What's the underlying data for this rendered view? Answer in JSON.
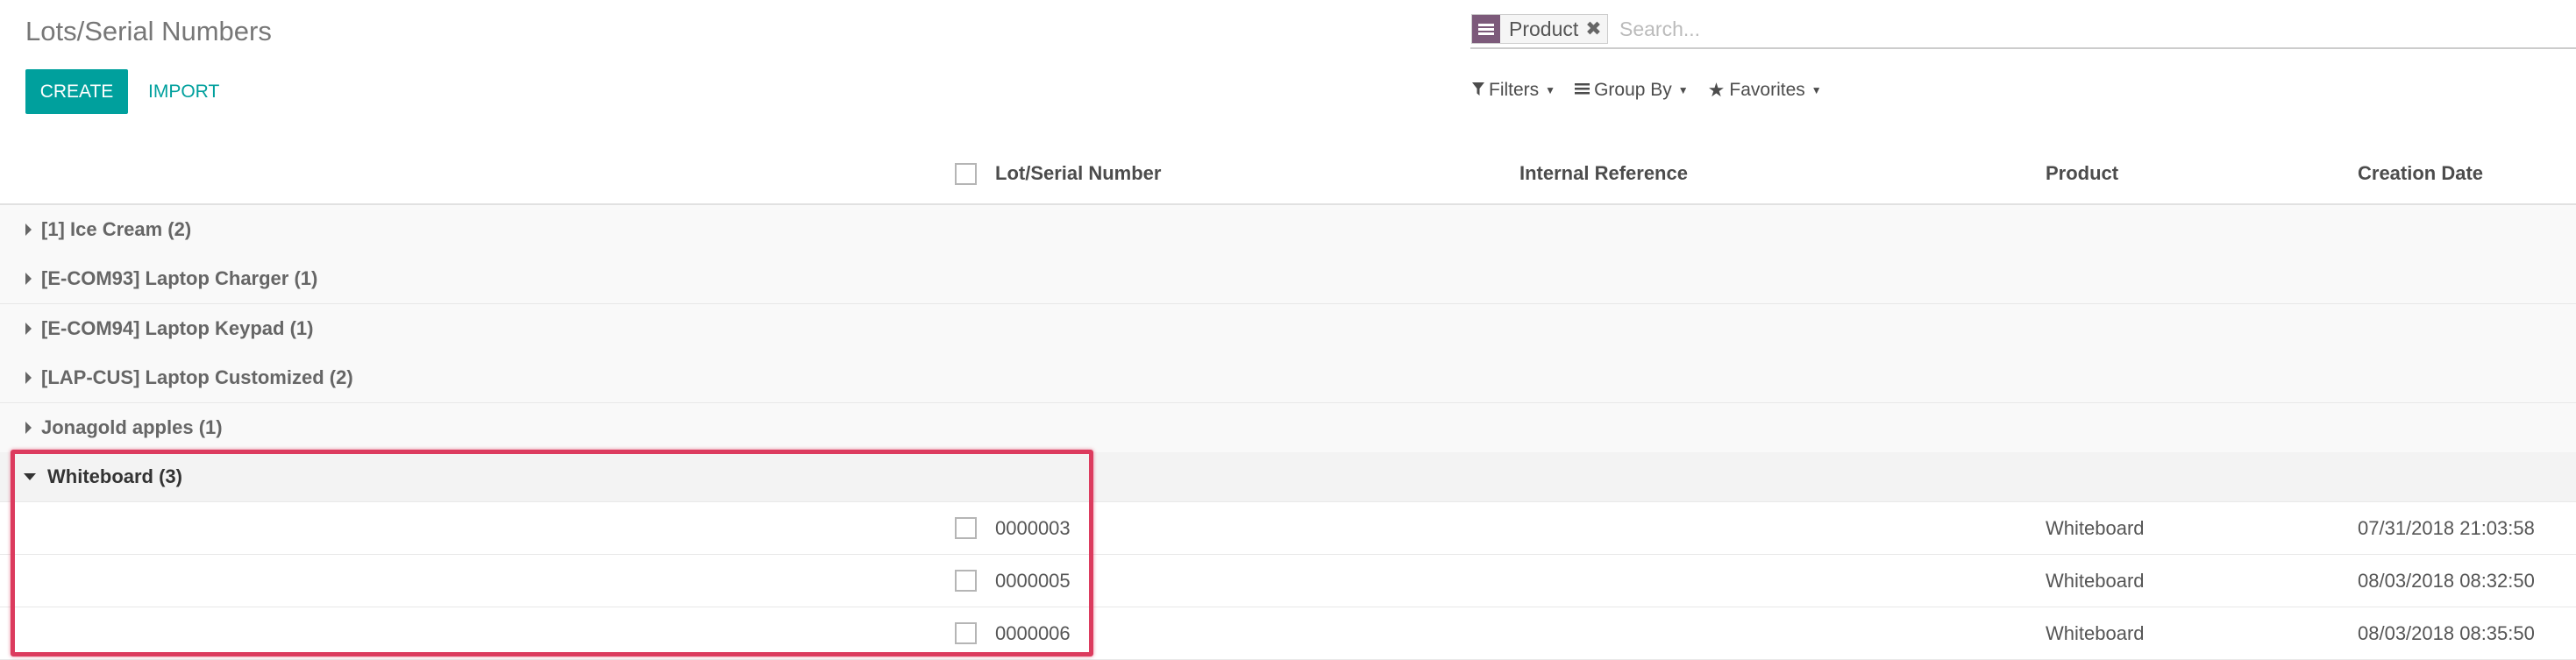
{
  "page": {
    "title": "Lots/Serial Numbers",
    "create_label": "CREATE",
    "import_label": "IMPORT"
  },
  "search": {
    "facet_value": "Product",
    "placeholder": "Search...",
    "facet_icon": "group-by-icon",
    "remove_icon": "close-icon"
  },
  "tools": {
    "filters": "Filters",
    "group_by": "Group By",
    "favorites": "Favorites"
  },
  "columns": {
    "lot": "Lot/Serial Number",
    "ref": "Internal Reference",
    "product": "Product",
    "date": "Creation Date"
  },
  "groups": [
    {
      "label": "[1] Ice Cream (2)"
    },
    {
      "label": "[E-COM93] Laptop Charger (1)"
    },
    {
      "label": "[E-COM94] Laptop Keypad (1)"
    },
    {
      "label": "[LAP-CUS] Laptop Customized (2)"
    },
    {
      "label": "Jonagold apples (1)"
    },
    {
      "label": "Whiteboard (3)",
      "expanded": true
    }
  ],
  "rows": [
    {
      "lot": "0000003",
      "ref": "",
      "product": "Whiteboard",
      "date": "07/31/2018 21:03:58"
    },
    {
      "lot": "0000005",
      "ref": "",
      "product": "Whiteboard",
      "date": "08/03/2018 08:32:50"
    },
    {
      "lot": "0000006",
      "ref": "",
      "product": "Whiteboard",
      "date": "08/03/2018 08:35:50"
    }
  ],
  "colors": {
    "accent": "#00a09d",
    "facet": "#7c5a7a",
    "highlight": "#dc3b5e"
  }
}
